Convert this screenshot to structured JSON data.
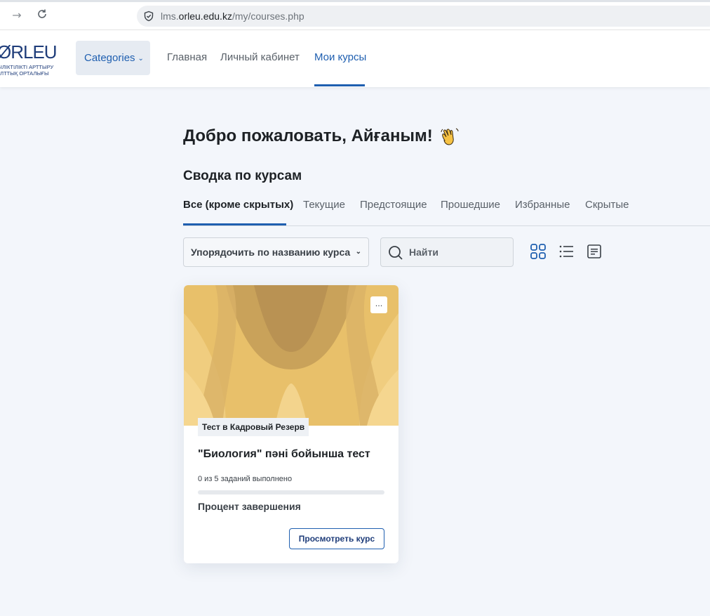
{
  "browser": {
    "url_prefix": "lms.",
    "url_domain": "orleu.edu.kz",
    "url_path": "/my/courses.php"
  },
  "header": {
    "logo": {
      "main": "ØRLEU",
      "sub_line1": "БІЛІКТІЛІКТІ АРТТЫРУ",
      "sub_line2": "ҰЛТТЫҚ ОРТАЛЫҒЫ"
    },
    "categories_label": "Categories",
    "nav": [
      {
        "label": "Главная"
      },
      {
        "label": "Личный кабинет"
      },
      {
        "label": "Мои курсы",
        "active": true
      }
    ]
  },
  "main": {
    "welcome": "Добро пожаловать, Айғаным!",
    "summary_title": "Сводка по курсам",
    "tabs": [
      {
        "label": "Все (кроме скрытых)",
        "active": true
      },
      {
        "label": "Текущие"
      },
      {
        "label": "Предстоящие"
      },
      {
        "label": "Прошедшие"
      },
      {
        "label": "Избранные"
      },
      {
        "label": "Скрытые"
      }
    ],
    "sort_label": "Упорядочить по названию курса",
    "search_placeholder": "Найти",
    "view_icons": [
      "grid-view-icon",
      "list-view-icon",
      "summary-view-icon"
    ]
  },
  "course": {
    "category": "Тест в Кадровый Резерв",
    "title": "\"Биология\" пәні бойынша тест",
    "progress_text": "0 из 5 заданий выполнено",
    "progress_fraction": 0,
    "percent_label": "Процент завершения",
    "view_button": "Просмотреть курс",
    "menu_label": "..."
  },
  "colors": {
    "accent": "#1f5fb0",
    "card_image": "#e8c06a"
  }
}
